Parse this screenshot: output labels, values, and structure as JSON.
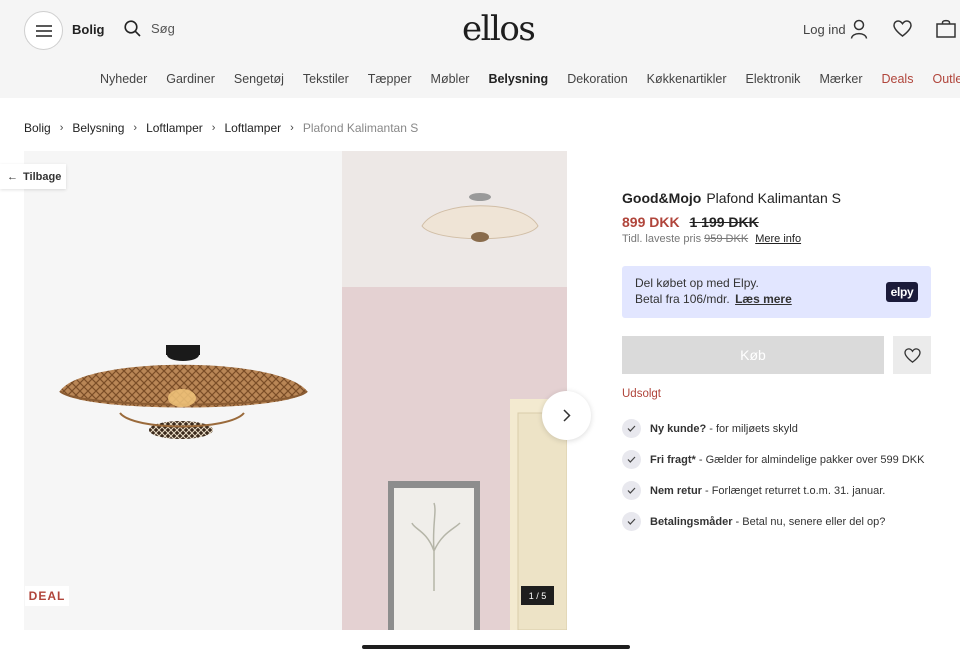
{
  "header": {
    "menu_label": "Bolig",
    "search_placeholder": "Søg",
    "logo": "ellos",
    "login": "Log ind",
    "nav": [
      "Nyheder",
      "Gardiner",
      "Sengetøj",
      "Tekstiler",
      "Tæpper",
      "Møbler",
      "Belysning",
      "Dekoration",
      "Køkkenartikler",
      "Elektronik",
      "Mærker",
      "Deals",
      "Outlet"
    ]
  },
  "breadcrumb": [
    "Bolig",
    "Belysning",
    "Loftlamper",
    "Loftlamper",
    "Plafond Kalimantan S"
  ],
  "gallery": {
    "back_label": "Tilbage",
    "deal_badge": "DEAL",
    "counter": "1 / 5"
  },
  "product": {
    "brand": "Good&Mojo",
    "name": "Plafond Kalimantan S",
    "price_now": "899 DKK",
    "price_old": "1 199 DKK",
    "prev_label": "Tidl. laveste pris",
    "prev_value": "959 DKK",
    "more_info": "Mere info",
    "soldout": "Udsolgt",
    "buy_label": "Køb"
  },
  "elpy": {
    "line1": "Del købet op med Elpy.",
    "line2": "Betal fra 106/mdr.",
    "read_more": "Læs mere",
    "logo": "elpy"
  },
  "usps": [
    {
      "bold": "Ny kunde?",
      "text": "- for miljøets skyld"
    },
    {
      "bold": "Fri fragt*",
      "text": "- Gælder for almindelige pakker over 599 DKK"
    },
    {
      "bold": "Nem retur",
      "text": "- Forlænget returret t.o.m. 31. januar."
    },
    {
      "bold": "Betalingsmåder",
      "text": "- Betal nu, senere eller del op?"
    }
  ],
  "colors": {
    "accent": "#b0453b",
    "elpy_bg": "#e2e6ff"
  }
}
